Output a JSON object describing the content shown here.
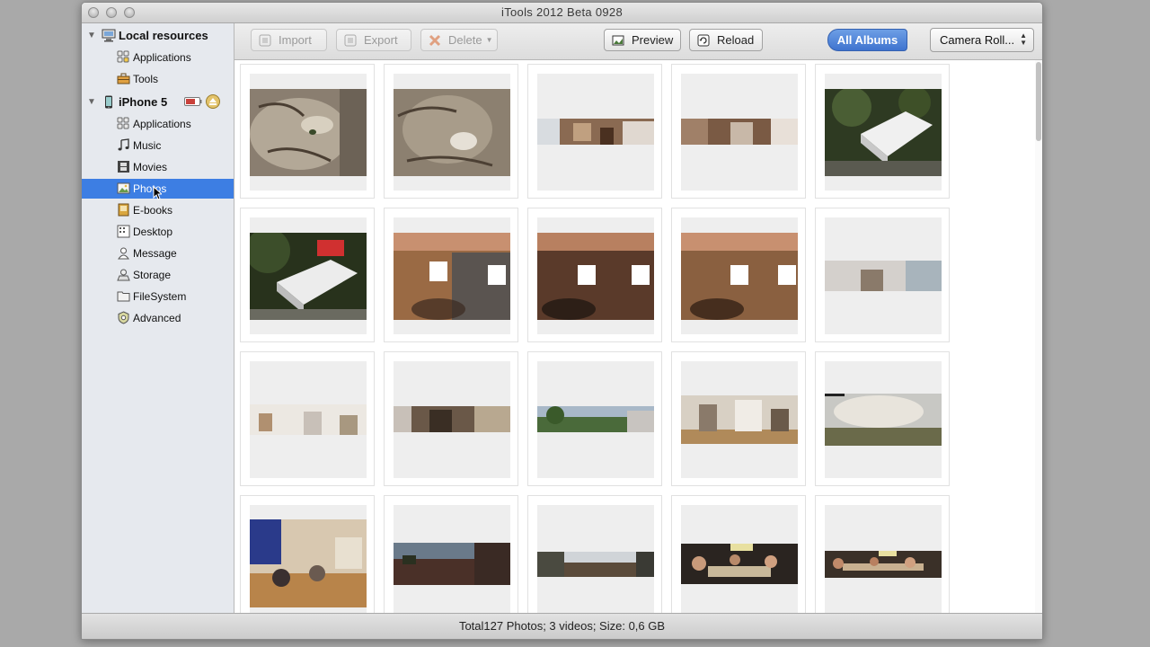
{
  "window": {
    "title": "iTools 2012 Beta 0928"
  },
  "sidebar": {
    "local": {
      "label": "Local resources",
      "items": [
        {
          "label": "Applications",
          "icon": "applications-icon"
        },
        {
          "label": "Tools",
          "icon": "toolbox-icon"
        }
      ]
    },
    "device": {
      "label": "iPhone 5",
      "items": [
        {
          "label": "Applications",
          "icon": "applications-icon"
        },
        {
          "label": "Music",
          "icon": "music-note-icon"
        },
        {
          "label": "Movies",
          "icon": "film-icon"
        },
        {
          "label": "Photos",
          "icon": "photo-icon",
          "selected": true
        },
        {
          "label": "E-books",
          "icon": "book-icon"
        },
        {
          "label": "Desktop",
          "icon": "desktop-icon"
        },
        {
          "label": "Message",
          "icon": "message-icon"
        },
        {
          "label": "Storage",
          "icon": "storage-icon"
        },
        {
          "label": "FileSystem",
          "icon": "folder-icon"
        },
        {
          "label": "Advanced",
          "icon": "gear-icon"
        }
      ]
    }
  },
  "toolbar": {
    "import_label": "Import",
    "export_label": "Export",
    "delete_label": "Delete",
    "preview_label": "Preview",
    "reload_label": "Reload",
    "all_albums_label": "All Albums",
    "album_select": "Camera Roll..."
  },
  "status": {
    "text": "Total127 Photos; 3 videos; Size: 0,6 GB"
  },
  "colors": {
    "selection": "#3d7ee3",
    "accent": "#4a7fd6"
  }
}
